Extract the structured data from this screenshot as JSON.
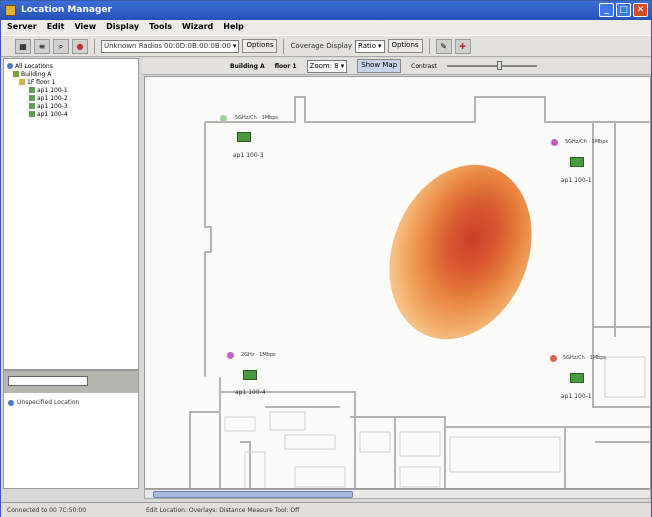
{
  "window": {
    "title": "Location Manager",
    "buttons": [
      "_",
      "□",
      "✕"
    ]
  },
  "menu": [
    "Server",
    "Edit",
    "View",
    "Display",
    "Tools",
    "Wizard",
    "Help"
  ],
  "toolbar": {
    "controller_label": "Unknown Radios",
    "controller_value": "00:0D:0B:00:0B:00",
    "options1": "Options",
    "coverage_label": "Coverage Display",
    "coverage_value": "Ratio",
    "options2": "Options"
  },
  "tree": [
    {
      "label": "All Locations",
      "level": 0,
      "icon": "globe"
    },
    {
      "label": "Building A",
      "level": 1,
      "icon": "bldg"
    },
    {
      "label": "1F floor 1",
      "level": 2,
      "icon": "floor"
    },
    {
      "label": "ap1 100-1",
      "level": 3,
      "icon": "ap"
    },
    {
      "label": "ap1 100-2",
      "level": 3,
      "icon": "ap"
    },
    {
      "label": "ap1 100-3",
      "level": 3,
      "icon": "ap"
    },
    {
      "label": "ap1 100-4",
      "level": 3,
      "icon": "ap"
    }
  ],
  "lower_panel": {
    "item": "Unspecified Location"
  },
  "map_toolbar": {
    "building": "Building A",
    "floor": "floor 1",
    "zoom_label": "Zoom: 8",
    "show_map": "Show Map",
    "contrast": "Contrast"
  },
  "aps": [
    {
      "name": "ap1 100-3",
      "info": "5GHz/Ch · 1Mbps",
      "dot": "#9ad49a"
    },
    {
      "name": "ap1 100-1",
      "info": "5GHz/Ch · 1Mbps",
      "dot": "#c060c0"
    },
    {
      "name": "ap1 100-4",
      "info": "2GHz · 1Mbps",
      "dot": "#c060c0"
    },
    {
      "name": "ap1 100-1",
      "info": "5GHz/Ch · 1Mbps",
      "dot": "#e06050"
    }
  ],
  "status": {
    "left": "Connected to 00 7C:50:00",
    "right": "Edit Location: Overlays: Distance Measure Tool: Off"
  }
}
